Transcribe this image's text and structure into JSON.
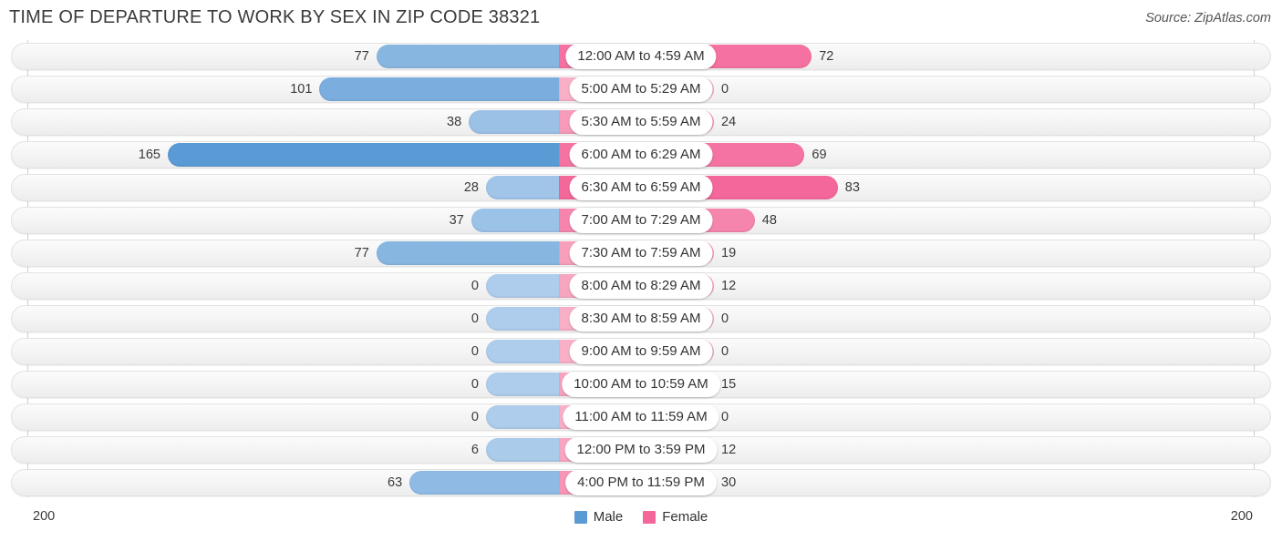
{
  "header": {
    "title": "TIME OF DEPARTURE TO WORK BY SEX IN ZIP CODE 38321",
    "source": "Source: ZipAtlas.com"
  },
  "legend": {
    "male_label": "Male",
    "female_label": "Female",
    "male_color": "#5b9bd5",
    "female_color": "#f4679b"
  },
  "axis": {
    "min_label": "200",
    "max_label": "200"
  },
  "chart_data": {
    "type": "bar",
    "orientation": "horizontal-diverging",
    "title": "TIME OF DEPARTURE TO WORK BY SEX IN ZIP CODE 38321",
    "xlabel": "",
    "ylabel": "",
    "axis_left_max": 200,
    "axis_right_max": 200,
    "grid": false,
    "legend_position": "bottom-center",
    "categories": [
      "12:00 AM to 4:59 AM",
      "5:00 AM to 5:29 AM",
      "5:30 AM to 5:59 AM",
      "6:00 AM to 6:29 AM",
      "6:30 AM to 6:59 AM",
      "7:00 AM to 7:29 AM",
      "7:30 AM to 7:59 AM",
      "8:00 AM to 8:29 AM",
      "8:30 AM to 8:59 AM",
      "9:00 AM to 9:59 AM",
      "10:00 AM to 10:59 AM",
      "11:00 AM to 11:59 AM",
      "12:00 PM to 3:59 PM",
      "4:00 PM to 11:59 PM"
    ],
    "series": [
      {
        "name": "Male",
        "values": [
          77,
          101,
          38,
          165,
          28,
          37,
          77,
          0,
          0,
          0,
          0,
          0,
          6,
          63
        ]
      },
      {
        "name": "Female",
        "values": [
          72,
          0,
          24,
          69,
          83,
          48,
          19,
          12,
          0,
          0,
          15,
          0,
          12,
          30
        ]
      }
    ]
  },
  "rows": [
    {
      "label": "12:00 AM to 4:59 AM",
      "male": "77",
      "female": "72"
    },
    {
      "label": "5:00 AM to 5:29 AM",
      "male": "101",
      "female": "0"
    },
    {
      "label": "5:30 AM to 5:59 AM",
      "male": "38",
      "female": "24"
    },
    {
      "label": "6:00 AM to 6:29 AM",
      "male": "165",
      "female": "69"
    },
    {
      "label": "6:30 AM to 6:59 AM",
      "male": "28",
      "female": "83"
    },
    {
      "label": "7:00 AM to 7:29 AM",
      "male": "37",
      "female": "48"
    },
    {
      "label": "7:30 AM to 7:59 AM",
      "male": "77",
      "female": "19"
    },
    {
      "label": "8:00 AM to 8:29 AM",
      "male": "0",
      "female": "12"
    },
    {
      "label": "8:30 AM to 8:59 AM",
      "male": "0",
      "female": "0"
    },
    {
      "label": "9:00 AM to 9:59 AM",
      "male": "0",
      "female": "0"
    },
    {
      "label": "10:00 AM to 10:59 AM",
      "male": "0",
      "female": "15"
    },
    {
      "label": "11:00 AM to 11:59 AM",
      "male": "0",
      "female": "0"
    },
    {
      "label": "12:00 PM to 3:59 PM",
      "male": "6",
      "female": "12"
    },
    {
      "label": "4:00 PM to 11:59 PM",
      "male": "63",
      "female": "30"
    }
  ]
}
